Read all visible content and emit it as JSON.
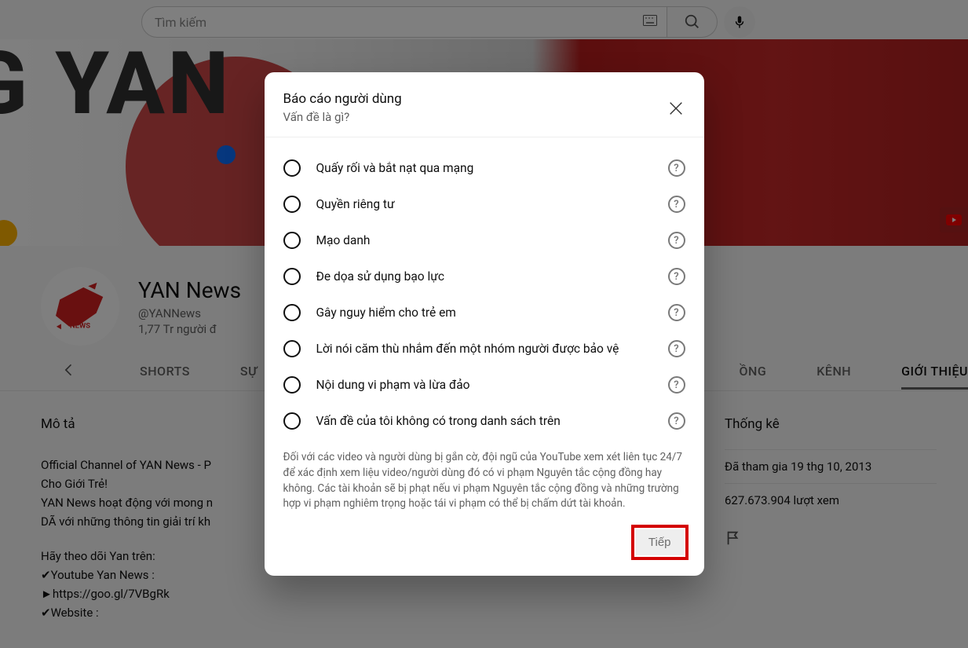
{
  "search": {
    "placeholder": "Tìm kiếm"
  },
  "banner_text": "G YAN",
  "channel": {
    "name": "YAN News",
    "handle": "@YANNews",
    "subscribers": "1,77 Tr người đ"
  },
  "tabs": {
    "shorts": "SHORTS",
    "events": "SỰ",
    "community": "ỒNG",
    "channels": "KÊNH",
    "about": "GIỚI THIỆU"
  },
  "about": {
    "heading": "Mô tả",
    "line1": "Official Channel of YAN News - P",
    "line1b": "Cho Giới Trẻ!",
    "line2": "YAN News hoạt động với mong n",
    "line3": "DÃ với những thông tin giải trí kh",
    "line4": "Hãy theo dõi Yan trên:",
    "line5": "✔Youtube Yan News :",
    "line6": "►https://goo.gl/7VBgRk",
    "line7": "✔Website :"
  },
  "stats": {
    "heading": "Thống kê",
    "joined": "Đã tham gia 19 thg 10, 2013",
    "views": "627.673.904 lượt xem"
  },
  "dialog": {
    "title": "Báo cáo người dùng",
    "subtitle": "Vấn đề là gì?",
    "options": [
      "Quấy rối và bắt nạt qua mạng",
      "Quyền riêng tư",
      "Mạo danh",
      "Đe dọa sử dụng bạo lực",
      "Gây nguy hiểm cho trẻ em",
      "Lời nói căm thù nhắm đến một nhóm người được bảo vệ",
      "Nội dung vi phạm và lừa đảo",
      "Vấn đề của tôi không có trong danh sách trên"
    ],
    "disclaimer": "Đối với các video và người dùng bị gắn cờ, đội ngũ của YouTube xem xét liên tục 24/7 để xác định xem liệu video/người dùng đó có vi phạm Nguyên tắc cộng đồng hay không. Các tài khoản sẽ bị phạt nếu vi phạm Nguyên tắc cộng đồng và những trường hợp vi phạm nghiêm trọng hoặc tái vi phạm có thể bị chấm dứt tài khoản.",
    "next": "Tiếp"
  }
}
